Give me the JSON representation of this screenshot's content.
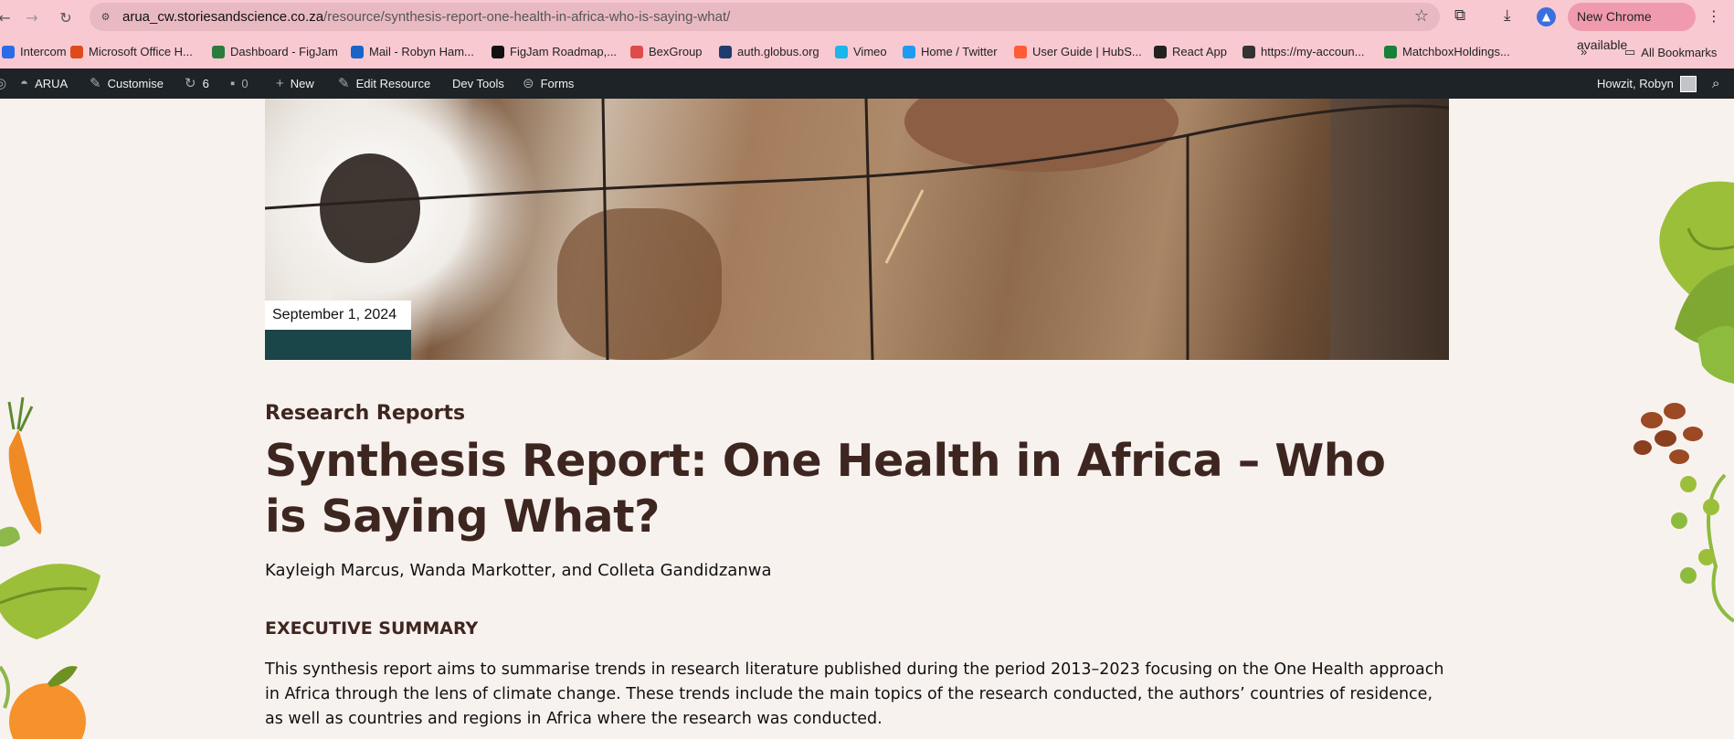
{
  "browser": {
    "url_domain": "arua_cw.storiesandscience.co.za",
    "url_path": "/resource/synthesis-report-one-health-in-africa-who-is-saying-what/",
    "new_chrome_label": "New Chrome available",
    "bookmarks": [
      {
        "label": "Intercom",
        "color": "#2b6be6"
      },
      {
        "label": "Microsoft Office H...",
        "color": "#e04a1b"
      },
      {
        "label": "Dashboard - FigJam",
        "color": "#2a7b3c"
      },
      {
        "label": "Mail - Robyn Ham...",
        "color": "#1a64c8"
      },
      {
        "label": "FigJam Roadmap,...",
        "color": "#111111"
      },
      {
        "label": "BexGroup",
        "color": "#e04a4a"
      },
      {
        "label": "auth.globus.org",
        "color": "#1f3c6e"
      },
      {
        "label": "Vimeo",
        "color": "#19b7ea"
      },
      {
        "label": "Home / Twitter",
        "color": "#1d9bf0"
      },
      {
        "label": "User Guide | HubS...",
        "color": "#ff5c35"
      },
      {
        "label": "React App",
        "color": "#222222"
      },
      {
        "label": "https://my-accoun...",
        "color": "#333333"
      },
      {
        "label": "MatchboxHoldings...",
        "color": "#188038"
      }
    ],
    "more_bookmarks": "»",
    "all_bookmarks_label": "All Bookmarks"
  },
  "adminbar": {
    "site_name": "ARUA",
    "customise": "Customise",
    "updates_count": "6",
    "comments_count": "0",
    "new": "New",
    "edit_resource": "Edit Resource",
    "dev_tools": "Dev Tools",
    "forms": "Forms",
    "greeting": "Howzit, Robyn"
  },
  "article": {
    "date": "September 1, 2024",
    "category": "Research Reports",
    "title": "Synthesis Report: One Health in Africa – Who is Saying What?",
    "authors": "Kayleigh Marcus, Wanda Markotter, and Colleta Gandidzanwa",
    "section_heading": "EXECUTIVE SUMMARY",
    "summary": "This synthesis report aims to summarise trends in research literature published during the period 2013–2023 focusing on the One Health approach in Africa through the lens of climate change. These trends include the main topics of the research conducted, the authors’ countries of residence, as well as countries and regions in Africa where the research was conducted."
  },
  "colors": {
    "heading": "#3e2620",
    "admin_bar": "#1d2327",
    "date_bar": "#1a4549",
    "page_bg": "#f8f2ef"
  }
}
